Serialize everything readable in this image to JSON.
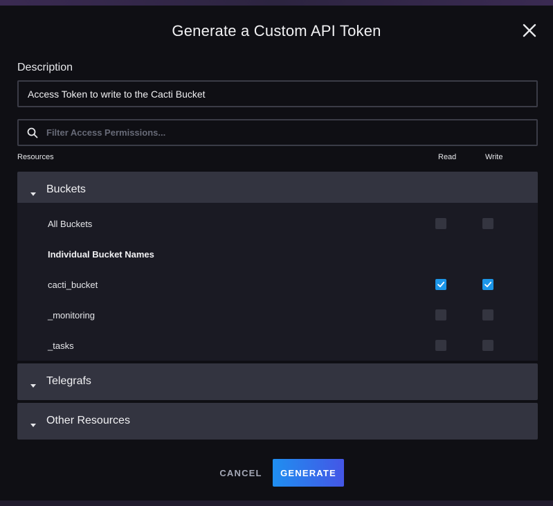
{
  "dialog": {
    "title": "Generate a Custom API Token"
  },
  "description": {
    "label": "Description",
    "value": "Access Token to write to the Cacti Bucket"
  },
  "filter": {
    "placeholder": "Filter Access Permissions..."
  },
  "columns": {
    "resources": "Resources",
    "read": "Read",
    "write": "Write"
  },
  "sections": {
    "buckets": {
      "label": "Buckets",
      "rows": [
        {
          "name": "All Buckets",
          "read": false,
          "write": false
        },
        {
          "name": "Individual Bucket Names",
          "heading": true
        },
        {
          "name": "cacti_bucket",
          "read": true,
          "write": true
        },
        {
          "name": "_monitoring",
          "read": false,
          "write": false
        },
        {
          "name": "_tasks",
          "read": false,
          "write": false
        }
      ]
    },
    "telegrafs": {
      "label": "Telegrafs"
    },
    "other": {
      "label": "Other Resources"
    }
  },
  "footer": {
    "cancel_label": "CANCEL",
    "generate_label": "GENERATE"
  },
  "colors": {
    "accent": "#1c96e8",
    "panel": "#333440",
    "modal_bg": "#0f0f14"
  },
  "icons": {
    "close": "close-icon",
    "search": "search-icon",
    "caret": "caret-down-icon",
    "check": "checkmark-icon"
  }
}
